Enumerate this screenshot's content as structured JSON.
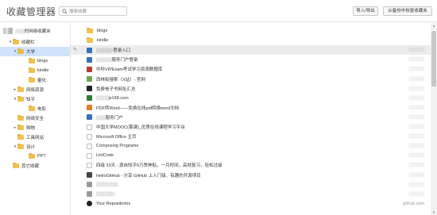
{
  "header": {
    "title": "收藏管理器",
    "search_placeholder": "搜索收藏",
    "import_label": "导入/导出",
    "restore_label": "从备份中恢复收藏夹"
  },
  "sidebar": {
    "root_label": "░░░的网络收藏夹",
    "items": [
      {
        "label": "收藏栏",
        "chevron": "▾"
      },
      {
        "label": "大学",
        "chevron": "▾"
      },
      {
        "label": "blogs",
        "chevron": ""
      },
      {
        "label": "kindle",
        "chevron": ""
      },
      {
        "label": "量化",
        "chevron": ""
      },
      {
        "label": "网络资源",
        "chevron": "▸"
      },
      {
        "label": "知乎",
        "chevron": "▾"
      },
      {
        "label": "电影",
        "chevron": ""
      },
      {
        "label": "网络安全",
        "chevron": ""
      },
      {
        "label": "购物",
        "chevron": "▸"
      },
      {
        "label": "工具网站",
        "chevron": ""
      },
      {
        "label": "设计",
        "chevron": "▾"
      },
      {
        "label": "PPT",
        "chevron": ""
      },
      {
        "label": "其它收藏",
        "chevron": ""
      }
    ]
  },
  "list": {
    "items": [
      {
        "title": "blogs",
        "url": "",
        "icon": "folder-icon",
        "color": "#f0c050"
      },
      {
        "title": "kindle",
        "url": "",
        "icon": "folder-icon",
        "color": "#f0c050"
      },
      {
        "title": "░░░░░-登录入口",
        "url": "░░░░░",
        "icon": "page-icon",
        "color": "#2f74c0"
      },
      {
        "title": "░░░░░服务门户登录",
        "url": "░░░░░",
        "icon": "page-icon",
        "color": "#2f74c0"
      },
      {
        "title": "中科VIPExam考试学习资源数据库",
        "url": "░░░░░",
        "icon": "page-icon",
        "color": "#c0392b"
      },
      {
        "title": "西林街搜索（X站）- 官网",
        "url": "░░░░░",
        "icon": "page-icon",
        "color": "#6aa84f"
      },
      {
        "title": "免费电子书网址汇总",
        "url": "░░░░░",
        "icon": "page-icon",
        "color": "#222222"
      },
      {
        "title": "░░░░js168.com",
        "url": "░░░░░",
        "icon": "page-icon",
        "color": "#2e7d32"
      },
      {
        "title": "PDF转Word——免费在线pdf转换word文档",
        "url": "░░░░░",
        "icon": "page-icon",
        "color": "#e67e22"
      },
      {
        "title": "░░░服务门户",
        "url": "░░░░░",
        "icon": "page-icon",
        "color": "#2f74c0"
      },
      {
        "title": "中国大学MOOC(慕课)_优质在线课程学习平台",
        "url": "░░░░░",
        "icon": "page-icon",
        "color": "#ffffff"
      },
      {
        "title": "Microsoft Office 主页",
        "url": "░░░░░",
        "icon": "page-icon",
        "color": "#ffffff"
      },
      {
        "title": "Composing Programs",
        "url": "░░░░░",
        "icon": "page-icon",
        "color": "#ffffff"
      },
      {
        "title": "LintCode",
        "url": "░░░░░",
        "icon": "page-icon",
        "color": "#ffffff"
      },
      {
        "title": "四级 33天 - 源自知乎5万赞神贴，一月时间，高效复习，轻松过级",
        "url": "░░░░░",
        "icon": "page-icon",
        "color": "#ffffff"
      },
      {
        "title": "HelloGitHub - 分享 GitHub 上入门级、有趣的开源项目",
        "url": "░░░░░",
        "icon": "page-icon",
        "color": "#444444"
      },
      {
        "title": "░░░░░░░",
        "url": "░░░░░",
        "icon": "page-icon",
        "color": "#999999"
      },
      {
        "title": "░░░░░░",
        "url": "░░░░░",
        "icon": "page-icon",
        "color": "#999999"
      },
      {
        "title": "Your Repositories",
        "url": "github.com",
        "icon": "github-icon",
        "color": "#222222"
      }
    ]
  }
}
